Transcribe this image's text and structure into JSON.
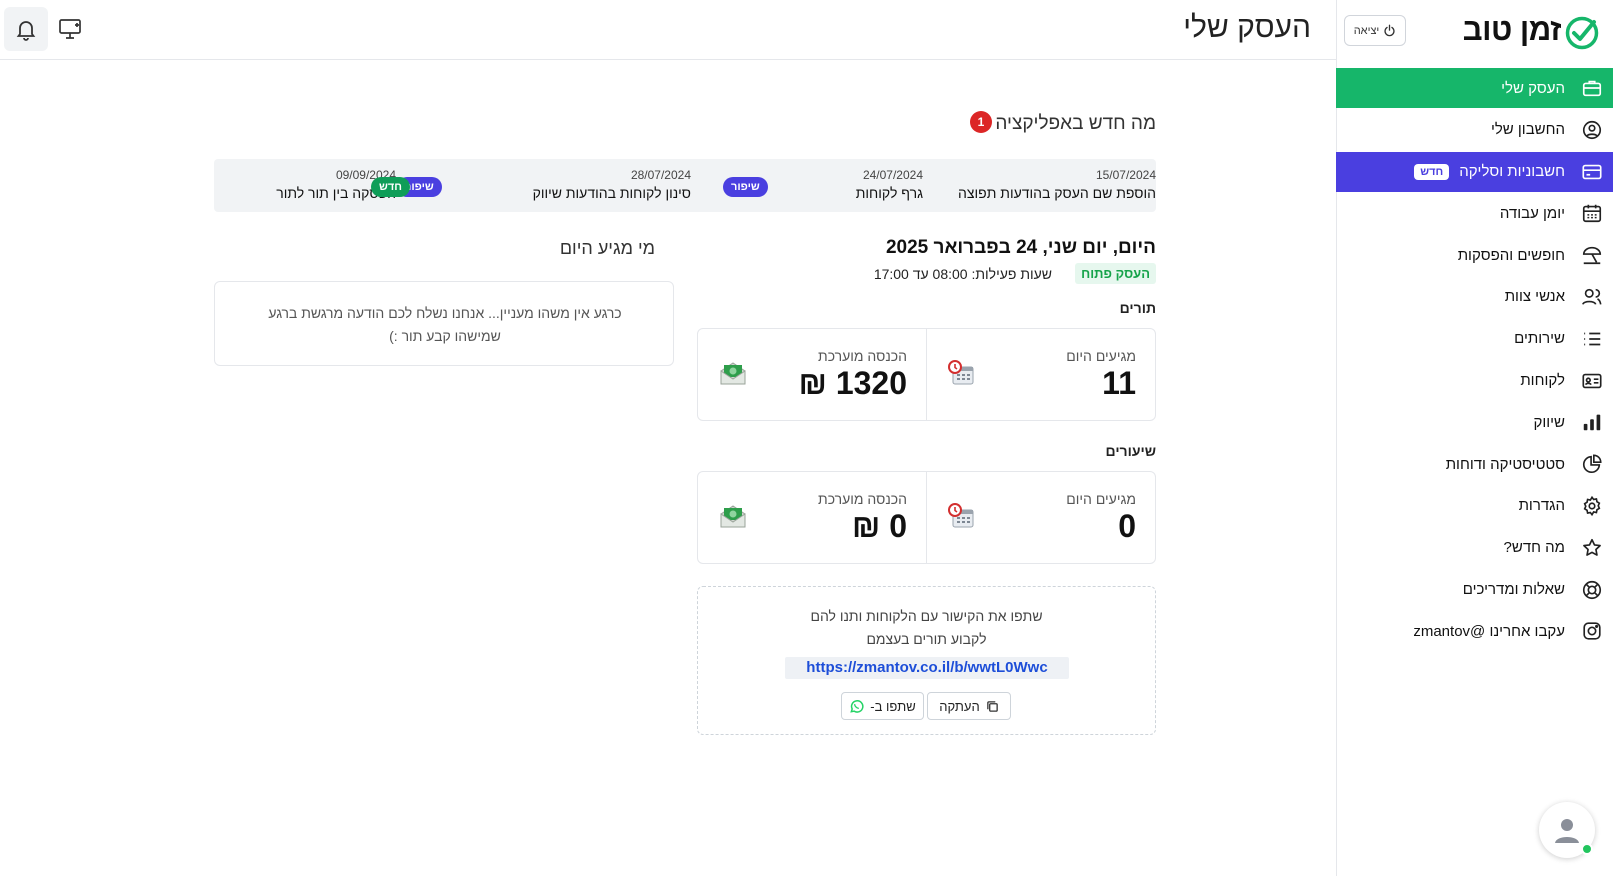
{
  "brand": {
    "name": "זמן טוב",
    "accent": "#16b66a",
    "accent_alt": "#4a3fe0"
  },
  "sidebar": {
    "logout_label": "יציאה",
    "items": [
      {
        "label": "העסק שלי",
        "icon": "briefcase-icon",
        "active": true
      },
      {
        "label": "החשבון שלי",
        "icon": "user-circle-icon"
      },
      {
        "label": "חשבוניות וסליקה",
        "icon": "credit-card-icon",
        "badge": "חדש"
      },
      {
        "label": "יומן עבודה",
        "icon": "calendar-icon"
      },
      {
        "label": "חופשים והפסקות",
        "icon": "beach-umbrella-icon"
      },
      {
        "label": "אנשי צוות",
        "icon": "users-icon"
      },
      {
        "label": "שירותים",
        "icon": "list-icon"
      },
      {
        "label": "לקוחות",
        "icon": "contact-card-icon"
      },
      {
        "label": "שיווק",
        "icon": "bar-chart-icon"
      },
      {
        "label": "סטטיסטיקה ודוחות",
        "icon": "pie-chart-icon"
      },
      {
        "label": "הגדרות",
        "icon": "gear-icon"
      },
      {
        "label": "מה חדש?",
        "icon": "star-icon"
      },
      {
        "label": "שאלות ומדריכים",
        "icon": "lifebuoy-icon"
      },
      {
        "label": "עקבו אחרינו @zmantov",
        "icon": "instagram-icon"
      }
    ]
  },
  "header": {
    "title": "העסק שלי"
  },
  "whats_new": {
    "title": "מה חדש באפליקציה",
    "count": "1",
    "items": [
      {
        "date": "15/07/2024",
        "text": "הוספת שם העסק בהודעות תפוצה",
        "badge": ""
      },
      {
        "date": "24/07/2024",
        "text": "גרף לקוחות",
        "badge": "שיפור"
      },
      {
        "date": "28/07/2024",
        "text": "סינון לקוחות בהודעות שיווק",
        "badge": "שיפור"
      },
      {
        "date": "09/09/2024",
        "text": "הפסקה בין תור לתור",
        "badge": "חדש"
      }
    ]
  },
  "today": {
    "title": "היום, יום שני, 24 בפברואר 2025",
    "status": "העסק פתוח",
    "hours": "שעות פעילות: 08:00 עד 17:00"
  },
  "appointments": {
    "label": "תורים",
    "arrivals_label": "מגיעים היום",
    "arrivals_value": "11",
    "income_label": "הכנסה מוערכת",
    "income_value": "1320 ₪"
  },
  "classes": {
    "label": "שיעורים",
    "arrivals_label": "מגיעים היום",
    "arrivals_value": "0",
    "income_label": "הכנסה מוערכת",
    "income_value": "0 ₪"
  },
  "share": {
    "text_line1": "שתפו את הקישור עם הלקוחות ותנו להם",
    "text_line2": "לקבוע תורים בעצמם",
    "link": "https://zmantov.co.il/b/wwtL0Wwc",
    "copy_label": "העתקה",
    "whatsapp_label": "שתפו ב-"
  },
  "arrivals": {
    "title": "מי מגיע היום",
    "empty_line1": "כרגע אין משהו מעניין... אנחנו נשלח לכם הודעה מרגשת ברגע",
    "empty_line2": "שמישהו קבע תור :)"
  }
}
